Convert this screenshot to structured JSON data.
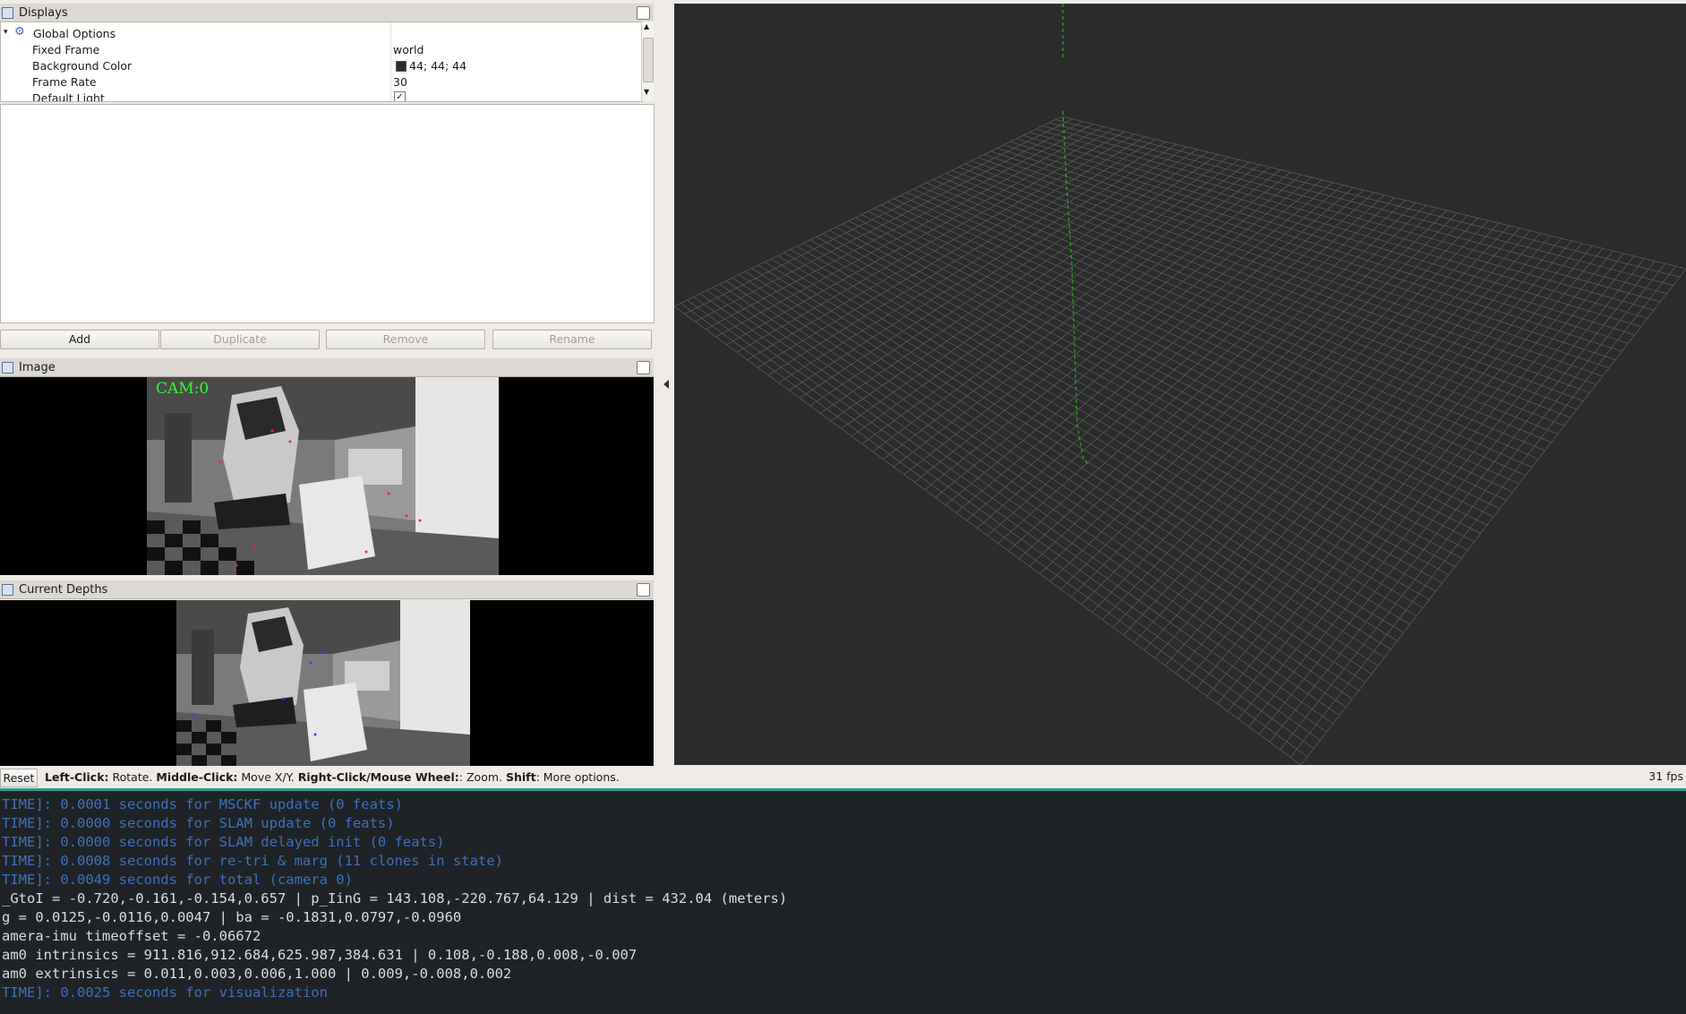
{
  "displays": {
    "title": "Displays",
    "tree": {
      "global_options": "Global Options",
      "rows": [
        {
          "label": "Fixed Frame",
          "value": "world"
        },
        {
          "label": "Background Color",
          "value": "44; 44; 44",
          "swatch": "#2c2c2c"
        },
        {
          "label": "Frame Rate",
          "value": "30"
        },
        {
          "label": "Default Light",
          "value": "✓"
        }
      ]
    },
    "buttons": {
      "add": "Add",
      "duplicate": "Duplicate",
      "remove": "Remove",
      "rename": "Rename"
    }
  },
  "image_panel": {
    "title": "Image",
    "overlay": "CAM:0"
  },
  "depths_panel": {
    "title": "Current Depths"
  },
  "statusbar": {
    "reset": "Reset",
    "hint_parts": [
      {
        "bold": "Left-Click:",
        "text": " Rotate. "
      },
      {
        "bold": "Middle-Click:",
        "text": " Move X/Y. "
      },
      {
        "bold": "Right-Click/Mouse Wheel:",
        "text": ": Zoom. "
      },
      {
        "bold": "Shift",
        "text": ": More options."
      }
    ],
    "fps": "31 fps"
  },
  "terminal": {
    "lines": [
      {
        "text": "TIME]: 0.0001 seconds for MSCKF update (0 feats)",
        "style": "blue"
      },
      {
        "text": "TIME]: 0.0000 seconds for SLAM update (0 feats)",
        "style": "blue"
      },
      {
        "text": "TIME]: 0.0000 seconds for SLAM delayed init (0 feats)",
        "style": "blue"
      },
      {
        "text": "TIME]: 0.0008 seconds for re-tri & marg (11 clones in state)",
        "style": "blue"
      },
      {
        "text": "TIME]: 0.0049 seconds for total (camera 0)",
        "style": "blue"
      },
      {
        "text": "_GtoI = -0.720,-0.161,-0.154,0.657 | p_IinG = 143.108,-220.767,64.129 | dist = 432.04 (meters)",
        "style": "white"
      },
      {
        "text": "g = 0.0125,-0.0116,0.0047 | ba = -0.1831,0.0797,-0.0960",
        "style": "white"
      },
      {
        "text": "amera-imu timeoffset = -0.06672",
        "style": "white"
      },
      {
        "text": "am0 intrinsics = 911.816,912.684,625.987,384.631 | 0.108,-0.188,0.008,-0.007",
        "style": "white"
      },
      {
        "text": "am0 extrinsics = 0.011,0.003,0.006,1.000 | 0.009,-0.008,0.002",
        "style": "white"
      },
      {
        "text": "TIME]: 0.0025 seconds for visualization",
        "style": "blue"
      }
    ]
  },
  "colors": {
    "grid_line": "#5a5a5a",
    "trajectory": "#2fa82f",
    "background": "#2c2c2c"
  }
}
